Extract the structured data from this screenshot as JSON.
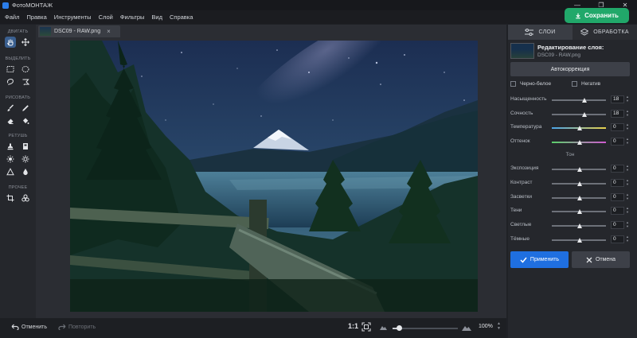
{
  "window": {
    "title": "ФотоМОНТАЖ",
    "controls": {
      "minimize": "—",
      "restore": "❐",
      "close": "✕"
    }
  },
  "menu": [
    "Файл",
    "Правка",
    "Инструменты",
    "Слой",
    "Фильтры",
    "Вид",
    "Справка"
  ],
  "save_button": "Сохранить",
  "tools": {
    "move_label": "ДВИГАТЬ",
    "select_label": "ВЫДЕЛИТЬ",
    "draw_label": "РИСОВАТЬ",
    "retouch_label": "РЕТУШЬ",
    "other_label": "ПРОЧЕЕ"
  },
  "document_tab": {
    "name": "DSC09 - RAW.png",
    "close": "×"
  },
  "bottom": {
    "undo": "Отменить",
    "redo": "Повторить",
    "ratio": "1:1",
    "zoom": "100%",
    "zoom_fraction": 0.1
  },
  "right_panel": {
    "tabs": {
      "layers": "СЛОИ",
      "processing": "ОБРАБОТКА"
    },
    "layer_title": "Редактирование слоя:",
    "layer_name": "DSC09 - RAW.png",
    "autocorrect": "Автокоррекция",
    "bw": "Черно-белое",
    "negative": "Негатив",
    "sliders_color": [
      {
        "label": "Насыщенность",
        "value": "18",
        "pos": 0.6,
        "track": "#6d7179"
      },
      {
        "label": "Сочность",
        "value": "18",
        "pos": 0.6,
        "track": "#6d7179"
      },
      {
        "label": "Температура",
        "value": "0",
        "pos": 0.5,
        "track": "linear-gradient(90deg,#4aa3e8,#e8d14a)"
      },
      {
        "label": "Оттенок",
        "value": "0",
        "pos": 0.5,
        "track": "linear-gradient(90deg,#5ad06a,#d05ad0)"
      }
    ],
    "tone_label": "Тон",
    "sliders_tone": [
      {
        "label": "Экспозиция",
        "value": "0",
        "pos": 0.5
      },
      {
        "label": "Контраст",
        "value": "0",
        "pos": 0.5
      },
      {
        "label": "Засветки",
        "value": "0",
        "pos": 0.5
      },
      {
        "label": "Тени",
        "value": "0",
        "pos": 0.5
      },
      {
        "label": "Светлые",
        "value": "0",
        "pos": 0.5
      },
      {
        "label": "Тёмные",
        "value": "0",
        "pos": 0.5
      }
    ],
    "apply": "Применить",
    "cancel": "Отмена"
  }
}
